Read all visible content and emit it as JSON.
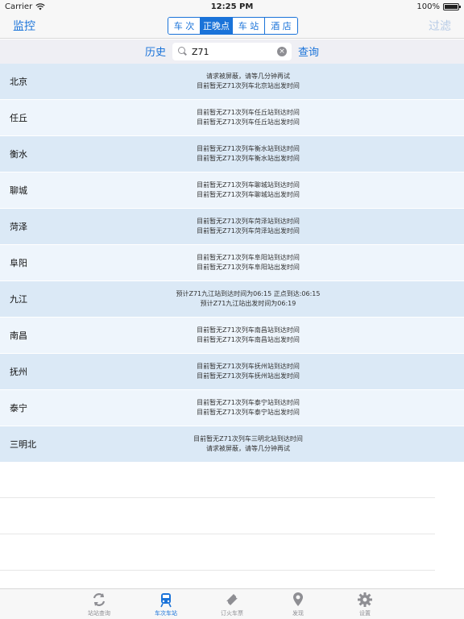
{
  "status": {
    "carrier": "Carrier",
    "time": "12:25 PM",
    "battery": "100%",
    "battery_level": 1.0
  },
  "nav": {
    "left": "监控",
    "right": "过滤",
    "segments": [
      {
        "label": "车 次",
        "active": false
      },
      {
        "label": "正晚点",
        "active": true
      },
      {
        "label": "车 站",
        "active": false
      },
      {
        "label": "酒 店",
        "active": false
      }
    ]
  },
  "search": {
    "history": "历史",
    "value": "Z71",
    "query": "查询"
  },
  "rows": [
    {
      "station": "北京",
      "lines": [
        "请求被屏蔽，请等几分钟再试",
        "目前暂无Z71次列车北京站出发时间"
      ]
    },
    {
      "station": "任丘",
      "lines": [
        "目前暂无Z71次列车任丘站到达时间",
        "目前暂无Z71次列车任丘站出发时间"
      ]
    },
    {
      "station": "衡水",
      "lines": [
        "目前暂无Z71次列车衡水站到达时间",
        "目前暂无Z71次列车衡水站出发时间"
      ]
    },
    {
      "station": "聊城",
      "lines": [
        "目前暂无Z71次列车聊城站到达时间",
        "目前暂无Z71次列车聊城站出发时间"
      ]
    },
    {
      "station": "菏泽",
      "lines": [
        "目前暂无Z71次列车菏泽站到达时间",
        "目前暂无Z71次列车菏泽站出发时间"
      ]
    },
    {
      "station": "阜阳",
      "lines": [
        "目前暂无Z71次列车阜阳站到达时间",
        "目前暂无Z71次列车阜阳站出发时间"
      ]
    },
    {
      "station": "九江",
      "lines": [
        "预计Z71九江站到达时间为06:15 正点到达:06:15",
        "预计Z71九江站出发时间为06:19"
      ]
    },
    {
      "station": "南昌",
      "lines": [
        "目前暂无Z71次列车南昌站到达时间",
        "目前暂无Z71次列车南昌站出发时间"
      ]
    },
    {
      "station": "抚州",
      "lines": [
        "目前暂无Z71次列车抚州站到达时间",
        "目前暂无Z71次列车抚州站出发时间"
      ]
    },
    {
      "station": "泰宁",
      "lines": [
        "目前暂无Z71次列车泰宁站到达时间",
        "目前暂无Z71次列车泰宁站出发时间"
      ]
    },
    {
      "station": "三明北",
      "lines": [
        "目前暂无Z71次列车三明北站到达时间",
        "请求被屏蔽，请等几分钟再试"
      ]
    }
  ],
  "tabs": [
    {
      "label": "站站查询",
      "icon": "refresh-icon",
      "active": false
    },
    {
      "label": "车次车站",
      "icon": "train-icon",
      "active": true
    },
    {
      "label": "订火车票",
      "icon": "ticket-icon",
      "active": false
    },
    {
      "label": "发现",
      "icon": "location-pin-icon",
      "active": false
    },
    {
      "label": "设置",
      "icon": "gear-icon",
      "active": false
    }
  ],
  "colors": {
    "accent": "#1a73d9",
    "row_odd": "#dbe9f6",
    "row_even": "#eef5fc",
    "inactive": "#8e8e93"
  }
}
